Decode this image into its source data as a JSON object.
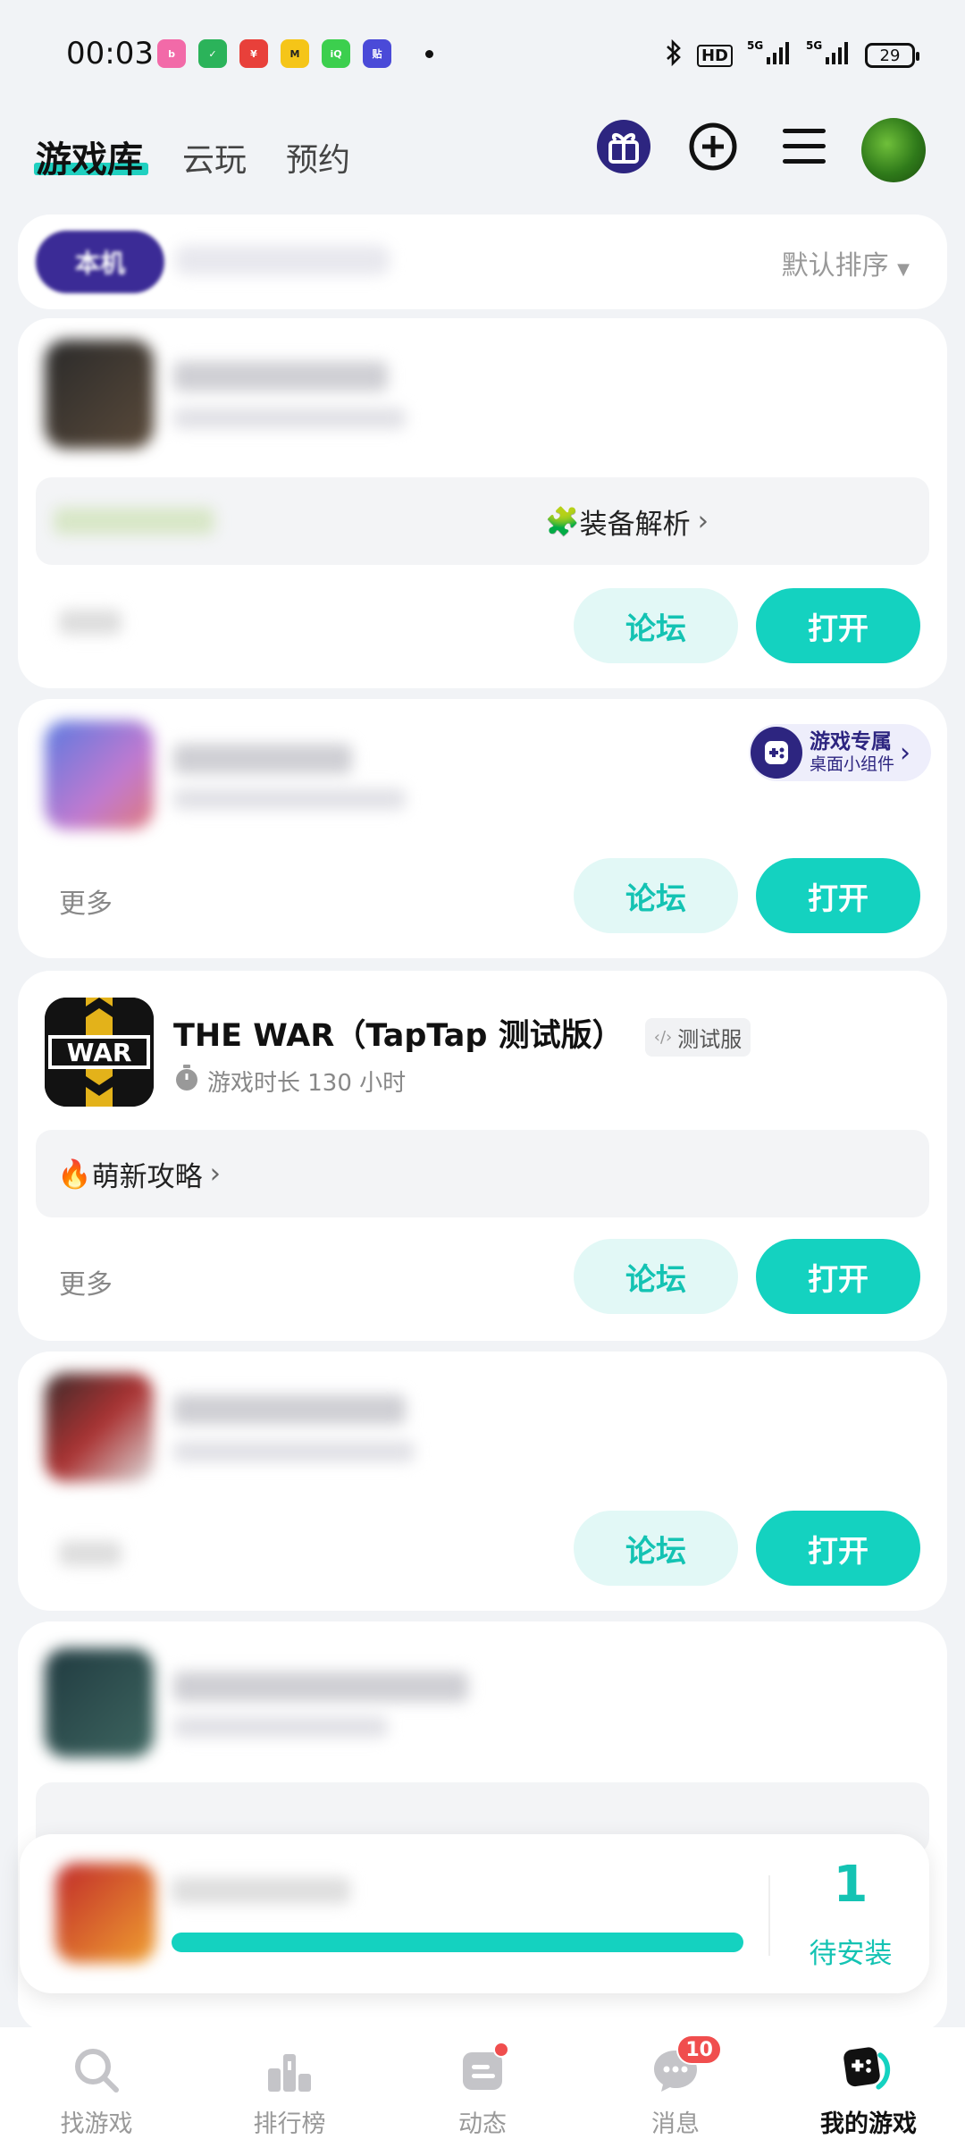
{
  "status_bar": {
    "time": "00:03",
    "battery": "29",
    "network": "5G",
    "hd_label": "HD"
  },
  "header": {
    "tab_active": "游戏库",
    "tab_cloud": "云玩",
    "tab_reserve": "预约",
    "icons": [
      "gift-icon",
      "add-circle-icon",
      "menu-icon",
      "avatar"
    ]
  },
  "filter": {
    "active_pill": "本机",
    "sort_label": "默认排序"
  },
  "cards": [
    {
      "strip_text": "装备解析",
      "forum_label": "论坛",
      "open_label": "打开"
    },
    {
      "widget_title": "游戏专属",
      "widget_sub": "桌面小组件",
      "more_label": "更多",
      "forum_label": "论坛",
      "open_label": "打开"
    },
    {
      "title": "THE WAR（TapTap 测试版）",
      "badge": "测试服",
      "playtime": "游戏时长 130 小时",
      "strip_text": "萌新攻略",
      "more_label": "更多",
      "forum_label": "论坛",
      "open_label": "打开"
    },
    {
      "forum_label": "论坛",
      "open_label": "打开"
    }
  ],
  "install": {
    "count": "1",
    "label": "待安装"
  },
  "bottom_nav": {
    "items": [
      {
        "label": "找游戏"
      },
      {
        "label": "排行榜"
      },
      {
        "label": "动态"
      },
      {
        "label": "消息",
        "badge": "10"
      },
      {
        "label": "我的游戏"
      }
    ]
  },
  "colors": {
    "accent": "#14d2c0",
    "accent_text": "#14c3b3",
    "forum_bg": "#e2f8f6",
    "brand_indigo": "#2d2580",
    "badge_red": "#f04e4e"
  }
}
